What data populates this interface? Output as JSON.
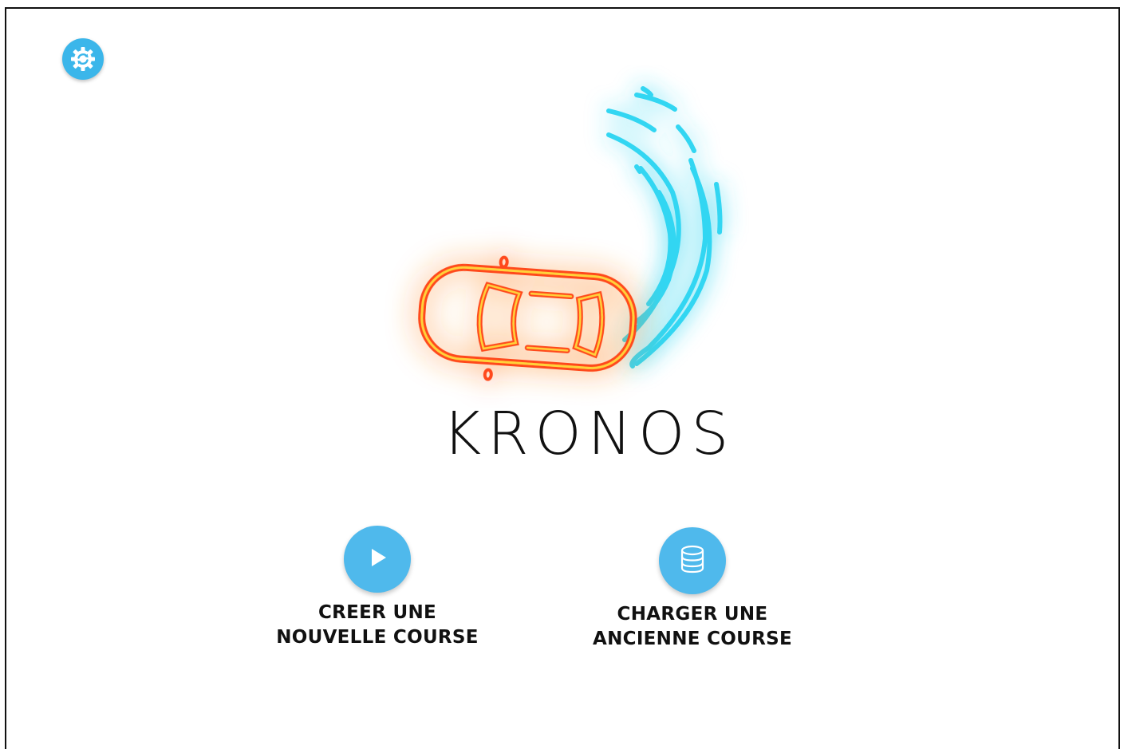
{
  "app": {
    "brand": "KRONOS"
  },
  "toolbar": {
    "settings_icon": "settings-sync-icon"
  },
  "actions": [
    {
      "icon": "play-icon",
      "label": "CREER UNE\nNOUVELLE COURSE"
    },
    {
      "icon": "database-icon",
      "label": "CHARGER UNE\nANCIENNE COURSE"
    }
  ],
  "colors": {
    "accent": "#4fb9ec",
    "neon_blue": "#33d6f2",
    "neon_red": "#ff4a1c",
    "neon_yellow": "#ffd23a",
    "text": "#111111"
  }
}
